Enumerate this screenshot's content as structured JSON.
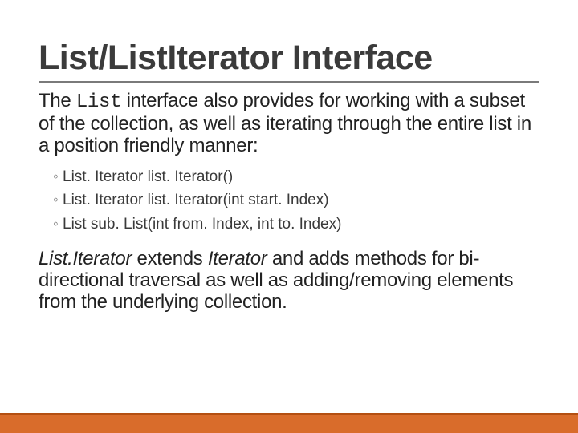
{
  "slide": {
    "title": "List/ListIterator Interface",
    "para1_pre": "The ",
    "para1_code": "List",
    "para1_post": " interface also provides for working with a subset of the collection, as well as iterating through the entire list in a position friendly manner:",
    "bullets": [
      "List. Iterator list. Iterator()",
      "List. Iterator list. Iterator(int start. Index)",
      "List sub. List(int from. Index, int to. Index)"
    ],
    "para2_em1": "List.Iterator",
    "para2_mid1": " extends ",
    "para2_em2": "Iterator",
    "para2_post": " and adds methods for bi-directional traversal as well as adding/removing elements from the underlying collection."
  }
}
